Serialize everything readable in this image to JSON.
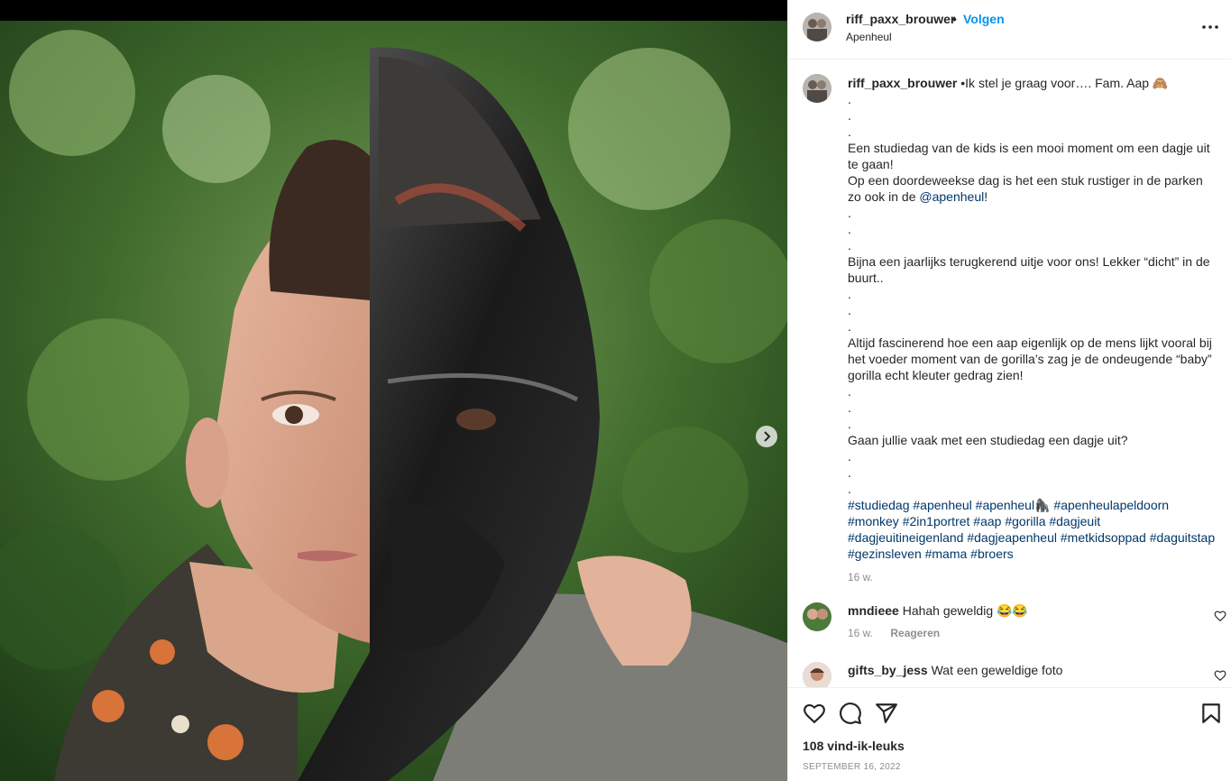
{
  "post": {
    "username": "riff_paxx_brouwer",
    "dot": "•",
    "follow_label": "Volgen",
    "location": "Apenheul",
    "more_icon": "more-options-icon"
  },
  "caption": {
    "username": "riff_paxx_brouwer",
    "lines": [
      "•Ik stel je graag voor…. Fam. Aap 🙈",
      ".",
      ".",
      ".",
      "Een studiedag van de kids is een mooi moment om een dagje uit te gaan!",
      "Op een doordeweekse dag is het een stuk rustiger in de parken zo ook in de "
    ],
    "mention": "@apenheul",
    "mention_after": "!",
    "lines2": [
      ".",
      ".",
      ".",
      "Bijna een jaarlijks terugkerend uitje voor ons! Lekker “dicht” in de buurt..",
      ".",
      ".",
      ".",
      "Altijd fascinerend hoe een aap eigenlijk op de mens lijkt vooral bij het voeder moment van de gorilla’s zag je de ondeugende “baby” gorilla echt kleuter gedrag zien!",
      ".",
      ".",
      ".",
      "Gaan jullie vaak met een studiedag een dagje uit?",
      ".",
      ".",
      "."
    ],
    "hashtags": "#studiedag #apenheul #apenheul🦍 #apenheulapeldoorn #monkey #2in1portret #aap #gorilla #dagjeuit #dagjeuitineigenland #dagjeapenheul #metkidsoppad #daguitstap #gezinsleven #mama #broers",
    "time": "16 w."
  },
  "comments": [
    {
      "username": "mndieee",
      "text": "Hahah geweldig 😂😂",
      "time": "16 w.",
      "reply_label": "Reageren"
    },
    {
      "username": "gifts_by_jess",
      "text": "Wat een geweldige foto"
    }
  ],
  "actions": {
    "like_icon": "heart-icon",
    "comment_icon": "comment-icon",
    "share_icon": "share-icon",
    "save_icon": "bookmark-icon"
  },
  "likes": "108 vind-ik-leuks",
  "date": "SEPTEMBER 16, 2022",
  "colors": {
    "link": "#00376b",
    "follow": "#0095f6",
    "muted": "#8e8e8e"
  }
}
